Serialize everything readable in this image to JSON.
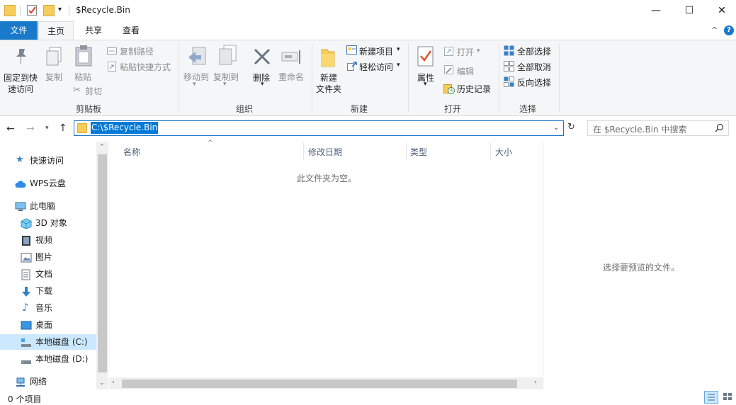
{
  "window": {
    "title": "$Recycle.Bin",
    "controls": {
      "minimize": "—",
      "maximize": "☐",
      "close": "✕"
    }
  },
  "ribbon_tabs": {
    "file": "文件",
    "home": "主页",
    "share": "共享",
    "view": "查看"
  },
  "ribbon": {
    "clipboard": {
      "group_label": "剪贴板",
      "pin_line1": "固定到快",
      "pin_line2": "速访问",
      "copy": "复制",
      "paste": "粘贴",
      "copy_path": "复制路径",
      "paste_shortcut": "粘贴快捷方式",
      "cut": "剪切"
    },
    "organize": {
      "group_label": "组织",
      "move_to": "移动到",
      "copy_to": "复制到",
      "delete": "删除",
      "rename": "重命名"
    },
    "new": {
      "group_label": "新建",
      "new_item": "新建项目",
      "easy_access": "轻松访问",
      "new_folder_line1": "新建",
      "new_folder_line2": "文件夹"
    },
    "open": {
      "group_label": "打开",
      "properties": "属性",
      "open": "打开",
      "edit": "编辑",
      "history": "历史记录"
    },
    "select": {
      "group_label": "选择",
      "select_all": "全部选择",
      "select_none": "全部取消",
      "invert": "反向选择"
    }
  },
  "address": {
    "path": "C:\\$Recycle.Bin"
  },
  "search": {
    "placeholder": "在 $Recycle.Bin 中搜索"
  },
  "nav": {
    "quick_access": "快速访问",
    "wps": "WPS云盘",
    "this_pc": "此电脑",
    "objects3d": "3D 对象",
    "videos": "视频",
    "pictures": "图片",
    "documents": "文档",
    "downloads": "下载",
    "music": "音乐",
    "desktop": "桌面",
    "drive_c": "本地磁盘 (C:)",
    "drive_d": "本地磁盘 (D:)",
    "network": "网络"
  },
  "columns": {
    "name": "名称",
    "modified": "修改日期",
    "type": "类型",
    "size": "大小"
  },
  "content": {
    "empty_message": "此文件夹为空。"
  },
  "preview": {
    "message": "选择要预览的文件。"
  },
  "status": {
    "item_count": "0 个项目"
  },
  "colors": {
    "accent": "#1979ca",
    "selection": "#0078d7",
    "nav_selected": "#cce8ff",
    "folder": "#f6cd5a"
  }
}
